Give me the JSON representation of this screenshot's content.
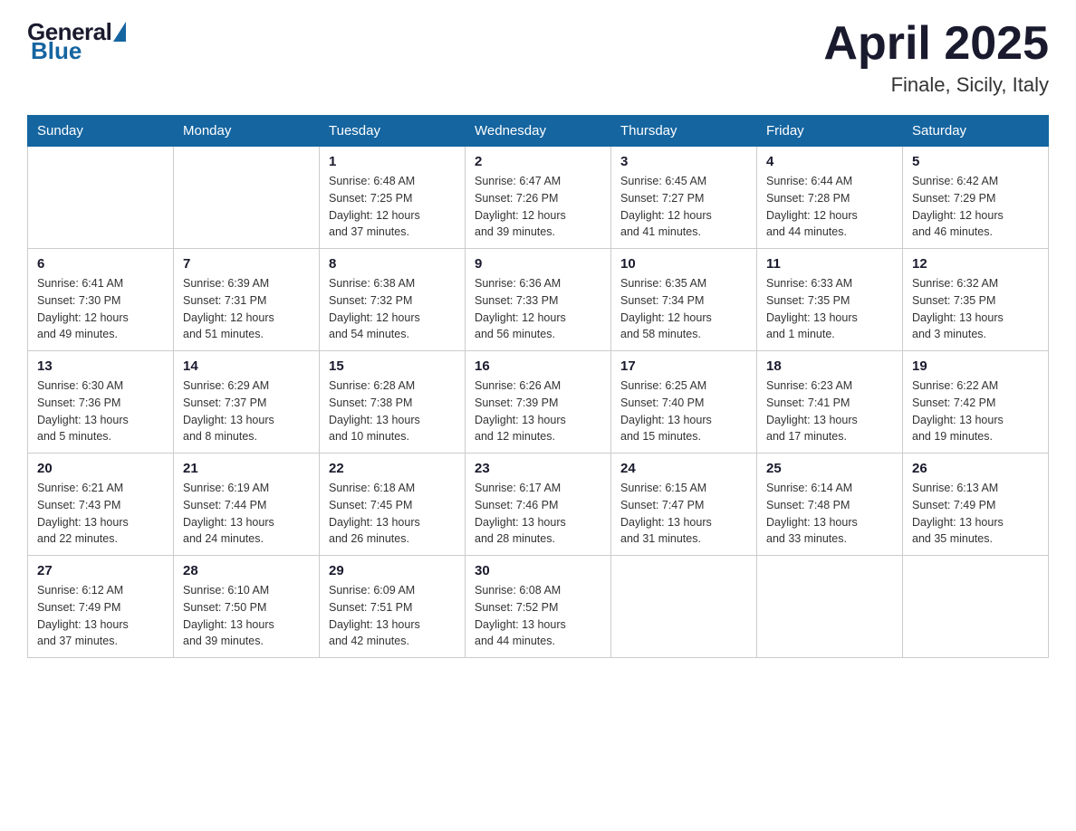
{
  "header": {
    "logo": {
      "general": "General",
      "blue": "Blue"
    },
    "title": "April 2025",
    "location": "Finale, Sicily, Italy"
  },
  "weekdays": [
    "Sunday",
    "Monday",
    "Tuesday",
    "Wednesday",
    "Thursday",
    "Friday",
    "Saturday"
  ],
  "weeks": [
    [
      {
        "day": "",
        "info": ""
      },
      {
        "day": "",
        "info": ""
      },
      {
        "day": "1",
        "info": "Sunrise: 6:48 AM\nSunset: 7:25 PM\nDaylight: 12 hours\nand 37 minutes."
      },
      {
        "day": "2",
        "info": "Sunrise: 6:47 AM\nSunset: 7:26 PM\nDaylight: 12 hours\nand 39 minutes."
      },
      {
        "day": "3",
        "info": "Sunrise: 6:45 AM\nSunset: 7:27 PM\nDaylight: 12 hours\nand 41 minutes."
      },
      {
        "day": "4",
        "info": "Sunrise: 6:44 AM\nSunset: 7:28 PM\nDaylight: 12 hours\nand 44 minutes."
      },
      {
        "day": "5",
        "info": "Sunrise: 6:42 AM\nSunset: 7:29 PM\nDaylight: 12 hours\nand 46 minutes."
      }
    ],
    [
      {
        "day": "6",
        "info": "Sunrise: 6:41 AM\nSunset: 7:30 PM\nDaylight: 12 hours\nand 49 minutes."
      },
      {
        "day": "7",
        "info": "Sunrise: 6:39 AM\nSunset: 7:31 PM\nDaylight: 12 hours\nand 51 minutes."
      },
      {
        "day": "8",
        "info": "Sunrise: 6:38 AM\nSunset: 7:32 PM\nDaylight: 12 hours\nand 54 minutes."
      },
      {
        "day": "9",
        "info": "Sunrise: 6:36 AM\nSunset: 7:33 PM\nDaylight: 12 hours\nand 56 minutes."
      },
      {
        "day": "10",
        "info": "Sunrise: 6:35 AM\nSunset: 7:34 PM\nDaylight: 12 hours\nand 58 minutes."
      },
      {
        "day": "11",
        "info": "Sunrise: 6:33 AM\nSunset: 7:35 PM\nDaylight: 13 hours\nand 1 minute."
      },
      {
        "day": "12",
        "info": "Sunrise: 6:32 AM\nSunset: 7:35 PM\nDaylight: 13 hours\nand 3 minutes."
      }
    ],
    [
      {
        "day": "13",
        "info": "Sunrise: 6:30 AM\nSunset: 7:36 PM\nDaylight: 13 hours\nand 5 minutes."
      },
      {
        "day": "14",
        "info": "Sunrise: 6:29 AM\nSunset: 7:37 PM\nDaylight: 13 hours\nand 8 minutes."
      },
      {
        "day": "15",
        "info": "Sunrise: 6:28 AM\nSunset: 7:38 PM\nDaylight: 13 hours\nand 10 minutes."
      },
      {
        "day": "16",
        "info": "Sunrise: 6:26 AM\nSunset: 7:39 PM\nDaylight: 13 hours\nand 12 minutes."
      },
      {
        "day": "17",
        "info": "Sunrise: 6:25 AM\nSunset: 7:40 PM\nDaylight: 13 hours\nand 15 minutes."
      },
      {
        "day": "18",
        "info": "Sunrise: 6:23 AM\nSunset: 7:41 PM\nDaylight: 13 hours\nand 17 minutes."
      },
      {
        "day": "19",
        "info": "Sunrise: 6:22 AM\nSunset: 7:42 PM\nDaylight: 13 hours\nand 19 minutes."
      }
    ],
    [
      {
        "day": "20",
        "info": "Sunrise: 6:21 AM\nSunset: 7:43 PM\nDaylight: 13 hours\nand 22 minutes."
      },
      {
        "day": "21",
        "info": "Sunrise: 6:19 AM\nSunset: 7:44 PM\nDaylight: 13 hours\nand 24 minutes."
      },
      {
        "day": "22",
        "info": "Sunrise: 6:18 AM\nSunset: 7:45 PM\nDaylight: 13 hours\nand 26 minutes."
      },
      {
        "day": "23",
        "info": "Sunrise: 6:17 AM\nSunset: 7:46 PM\nDaylight: 13 hours\nand 28 minutes."
      },
      {
        "day": "24",
        "info": "Sunrise: 6:15 AM\nSunset: 7:47 PM\nDaylight: 13 hours\nand 31 minutes."
      },
      {
        "day": "25",
        "info": "Sunrise: 6:14 AM\nSunset: 7:48 PM\nDaylight: 13 hours\nand 33 minutes."
      },
      {
        "day": "26",
        "info": "Sunrise: 6:13 AM\nSunset: 7:49 PM\nDaylight: 13 hours\nand 35 minutes."
      }
    ],
    [
      {
        "day": "27",
        "info": "Sunrise: 6:12 AM\nSunset: 7:49 PM\nDaylight: 13 hours\nand 37 minutes."
      },
      {
        "day": "28",
        "info": "Sunrise: 6:10 AM\nSunset: 7:50 PM\nDaylight: 13 hours\nand 39 minutes."
      },
      {
        "day": "29",
        "info": "Sunrise: 6:09 AM\nSunset: 7:51 PM\nDaylight: 13 hours\nand 42 minutes."
      },
      {
        "day": "30",
        "info": "Sunrise: 6:08 AM\nSunset: 7:52 PM\nDaylight: 13 hours\nand 44 minutes."
      },
      {
        "day": "",
        "info": ""
      },
      {
        "day": "",
        "info": ""
      },
      {
        "day": "",
        "info": ""
      }
    ]
  ]
}
